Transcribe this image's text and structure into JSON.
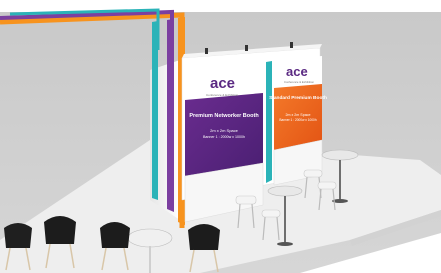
{
  "scene": {
    "subject": "exhibition-booth-render",
    "colors": {
      "background": "#ffffff",
      "floor": "#d9d9d9",
      "platform": "#efefef",
      "purple": "#5b2a83",
      "orange": "#f26522",
      "teal": "#2bb3b8",
      "tube_orange": "#f7931e",
      "tube_purple": "#7b3fa0"
    }
  },
  "panels": {
    "left": {
      "logo": "ace",
      "logo_tag": "Conference & Exhibition",
      "title": "Premium Networker Booth",
      "size": "2m x 2m Space",
      "banner": "Banner 1 : 2000w x 1000h"
    },
    "right": {
      "logo": "ace",
      "logo_tag": "Conference & Exhibition",
      "title": "Standard Premium Booth",
      "size": "2m x 2m Space",
      "banner": "Banner 1 : 2000w x 1000h"
    }
  }
}
